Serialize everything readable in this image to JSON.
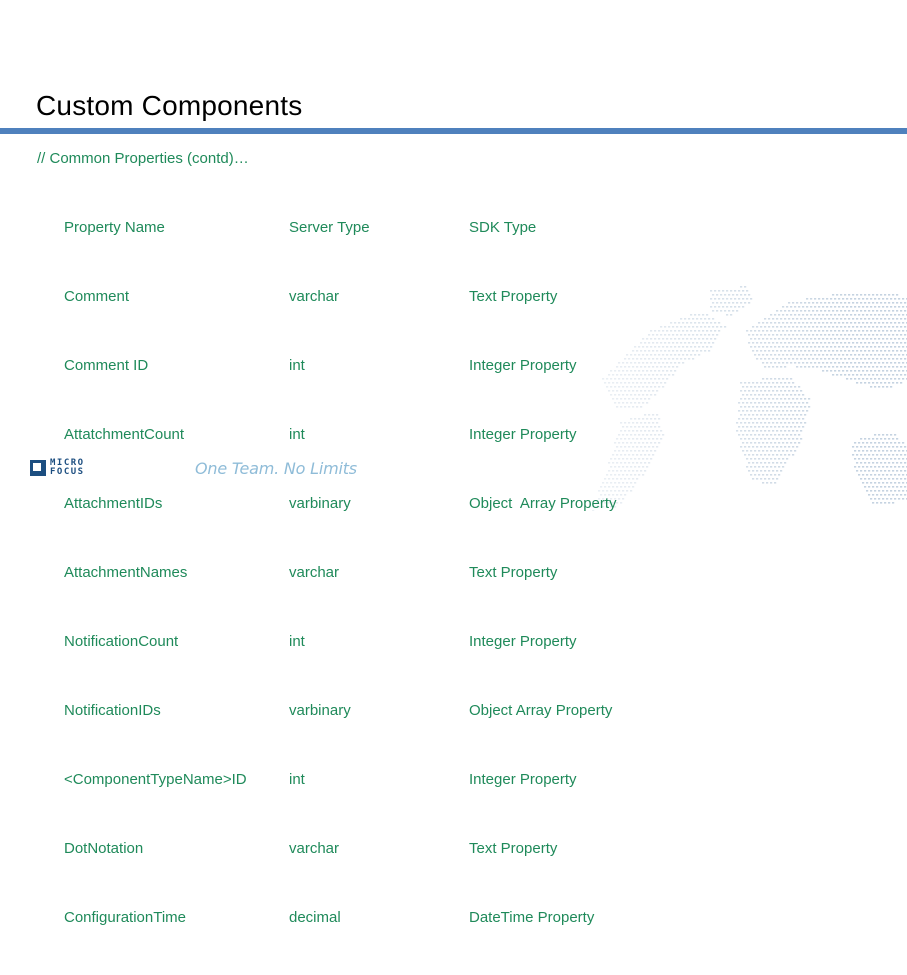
{
  "slide": {
    "title": "Custom Components",
    "accent_color": "#4f81bd",
    "text_color": "#1f8a5a"
  },
  "content": {
    "section_comment": "// Common Properties (contd)…",
    "headers": {
      "property_name": "Property Name",
      "server_type": "Server Type",
      "sdk_type": "SDK Type"
    },
    "rows": [
      {
        "property_name": "Comment",
        "server_type": "varchar",
        "sdk_type": "Text Property"
      },
      {
        "property_name": "Comment ID",
        "server_type": "int",
        "sdk_type": "Integer Property"
      },
      {
        "property_name": "AttatchmentCount",
        "server_type": "int",
        "sdk_type": "Integer Property"
      },
      {
        "property_name": "AttachmentIDs",
        "server_type": "varbinary",
        "sdk_type": "Object  Array Property"
      },
      {
        "property_name": "AttachmentNames",
        "server_type": "varchar",
        "sdk_type": "Text Property"
      },
      {
        "property_name": "NotificationCount",
        "server_type": "int",
        "sdk_type": "Integer Property"
      },
      {
        "property_name": "NotificationIDs",
        "server_type": "varbinary",
        "sdk_type": "Object Array Property"
      },
      {
        "property_name": "<ComponentTypeName>ID",
        "server_type": "int",
        "sdk_type": "Integer Property"
      },
      {
        "property_name": "DotNotation",
        "server_type": "varchar",
        "sdk_type": "Text Property"
      },
      {
        "property_name": "ConfigurationTime",
        "server_type": "decimal",
        "sdk_type": "DateTime Property"
      }
    ]
  },
  "footer": {
    "logo_line1": "MICRO",
    "logo_line2": "FOCUS",
    "tagline": "One Team. No Limits",
    "logo_color": "#1c4e80",
    "tagline_color": "#8fbcd8"
  },
  "decor": {
    "background_graphic": "dotted-world-map"
  }
}
